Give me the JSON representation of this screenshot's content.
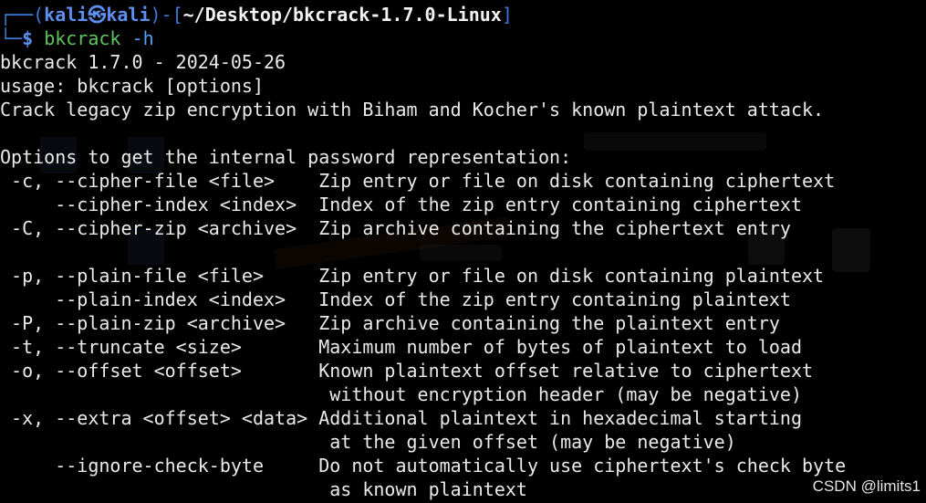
{
  "prompt": {
    "frame_open": "┌──(",
    "user": "kali",
    "skull": "㉿",
    "host": "kali",
    "frame_mid": ")-[",
    "path": "~/Desktop/bkcrack-1.7.0-Linux",
    "frame_close": "]",
    "frame_second": "└─",
    "dollar": "$",
    "command_name": "bkcrack",
    "command_args": " -h"
  },
  "output_lines": [
    "bkcrack 1.7.0 - 2024-05-26",
    "usage: bkcrack [options]",
    "Crack legacy zip encryption with Biham and Kocher's known plaintext attack.",
    "",
    "Options to get the internal password representation:",
    " -c, --cipher-file <file>    Zip entry or file on disk containing ciphertext",
    "     --cipher-index <index>  Index of the zip entry containing ciphertext",
    " -C, --cipher-zip <archive>  Zip archive containing the ciphertext entry",
    "",
    " -p, --plain-file <file>     Zip entry or file on disk containing plaintext",
    "     --plain-index <index>   Index of the zip entry containing plaintext",
    " -P, --plain-zip <archive>   Zip archive containing the plaintext entry",
    " -t, --truncate <size>       Maximum number of bytes of plaintext to load",
    " -o, --offset <offset>       Known plaintext offset relative to ciphertext",
    "                              without encryption header (may be negative)",
    " -x, --extra <offset> <data> Additional plaintext in hexadecimal starting",
    "                              at the given offset (may be negative)",
    "     --ignore-check-byte     Do not automatically use ciphertext's check byte",
    "                              as known plaintext"
  ],
  "watermark": "CSDN @limits1",
  "colors": {
    "background": "#000000",
    "text": "#eaeaea",
    "prompt_accent": "#5d8ff0",
    "command": "#5ec45e",
    "argument": "#4fa3f7"
  }
}
